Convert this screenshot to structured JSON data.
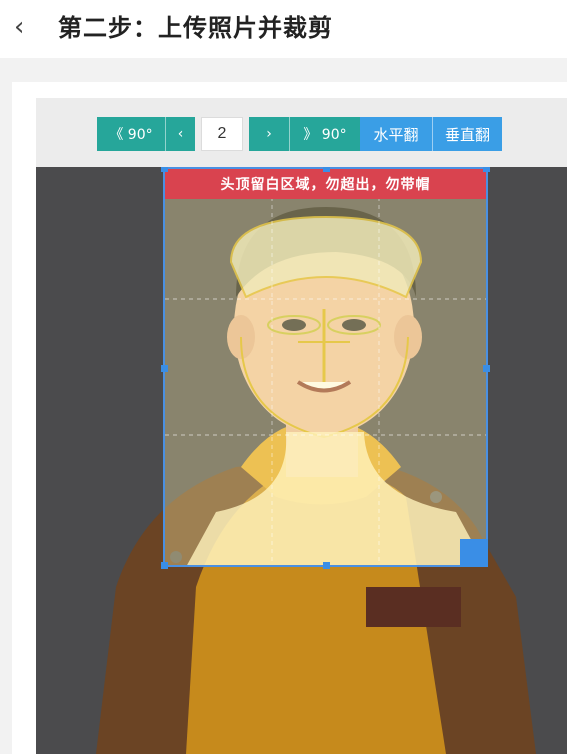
{
  "header": {
    "back_icon": "chevron-left-icon",
    "back_glyph": "‹",
    "title": "第二步：上传照片并裁剪"
  },
  "toolbar": {
    "rotate_left_label": "《 90°",
    "prev_label": "‹",
    "page_number": "2",
    "next_label": "›",
    "rotate_right_label": "》 90°",
    "flip_horizontal_label": "水平翻",
    "flip_vertical_label": "垂直翻"
  },
  "crop": {
    "hint": "头顶留白区域，勿超出，勿带帽"
  },
  "colors": {
    "teal": "#26a69a",
    "blue": "#3a9ee6",
    "banner_red": "#d9434f",
    "guide_yellow": "#fff0a8"
  }
}
